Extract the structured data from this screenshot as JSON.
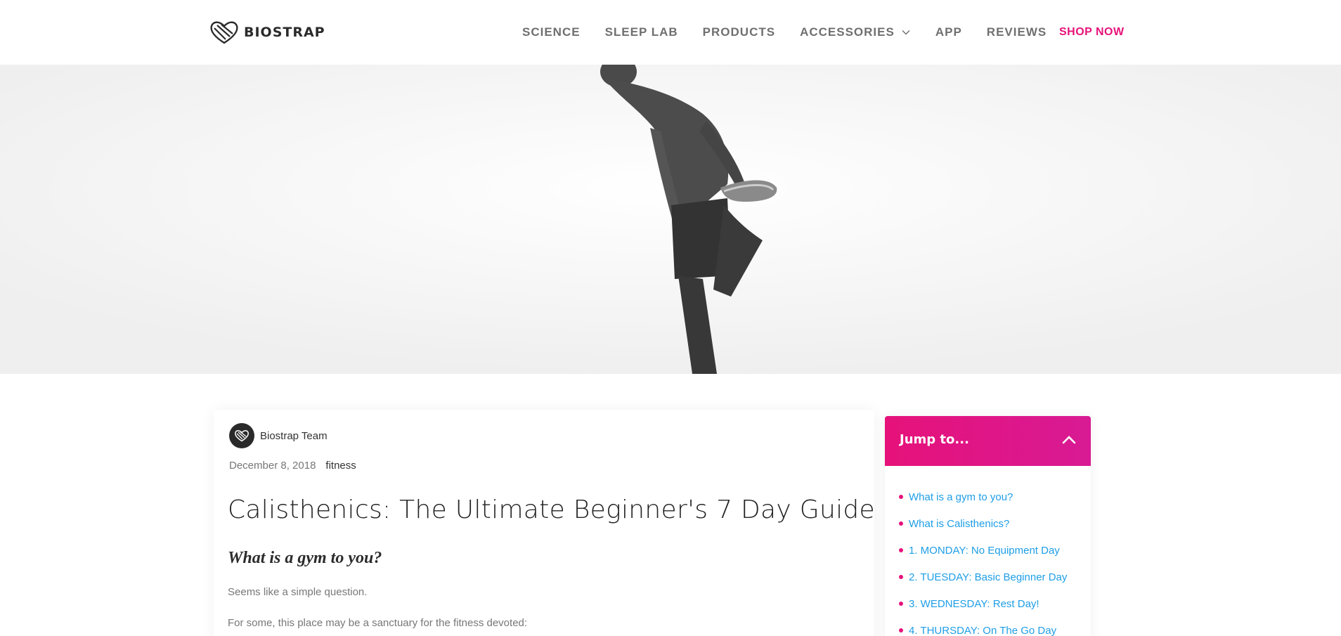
{
  "brand": {
    "name": "BIOSTRAP",
    "accent": "#e6127a",
    "link_color": "#1e9ee6"
  },
  "nav": {
    "items": [
      {
        "label": "SCIENCE"
      },
      {
        "label": "SLEEP LAB"
      },
      {
        "label": "PRODUCTS"
      },
      {
        "label": "ACCESSORIES",
        "icon": "chevron-down-icon"
      },
      {
        "label": "APP"
      },
      {
        "label": "REVIEWS"
      }
    ],
    "cta": "SHOP NOW"
  },
  "hero": {
    "image": "person-stretching-leg-photo"
  },
  "article": {
    "author": "Biostrap Team",
    "date": "December 8, 2018",
    "category": "fitness",
    "title": "Calisthenics: The Ultimate Beginner's 7 Day Guide",
    "subheading": "What is a gym to you?",
    "paragraphs": [
      "Seems like a simple question.",
      "For some, this place may be a sanctuary for the fitness devoted:"
    ]
  },
  "toc": {
    "title": "Jump to...",
    "toggle_icon": "chevron-up-icon",
    "items": [
      "What is a gym to you?",
      "What is Calisthenics?",
      "1. MONDAY: No Equipment Day",
      "2. TUESDAY: Basic Beginner Day",
      "3. WEDNESDAY: Rest Day!",
      "4. THURSDAY: On The Go Day"
    ]
  }
}
